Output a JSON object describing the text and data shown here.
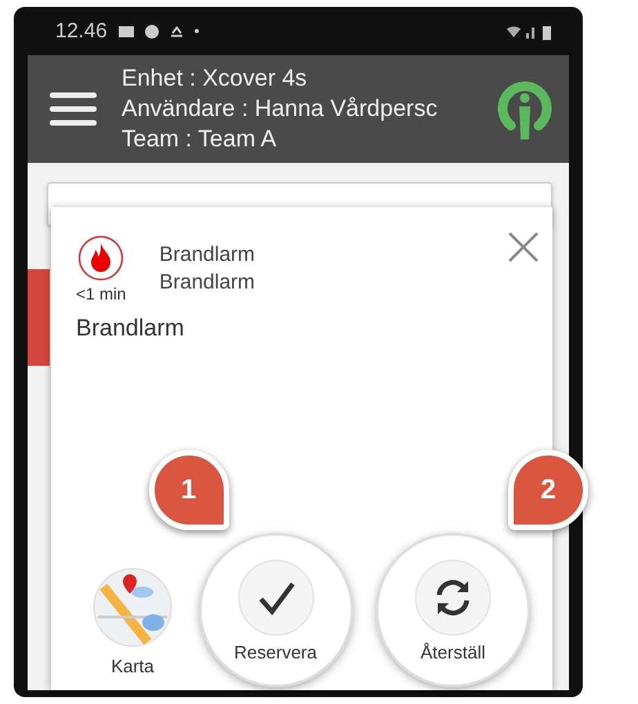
{
  "status_bar": {
    "time": "12.46"
  },
  "header": {
    "lines": [
      "Enhet : Xcover 4s",
      "Användare : Hanna Vårdpersc",
      "Team : Team A"
    ]
  },
  "alarm": {
    "title": "Brandlarm",
    "subtitle": "Brandlarm",
    "age": "<1 min",
    "description": "Brandlarm"
  },
  "actions": [
    {
      "kind": "map",
      "label": "Karta"
    },
    {
      "kind": "check",
      "label": "Reservera",
      "callout": "1"
    },
    {
      "kind": "refresh",
      "label": "Återställ",
      "callout": "2"
    }
  ]
}
